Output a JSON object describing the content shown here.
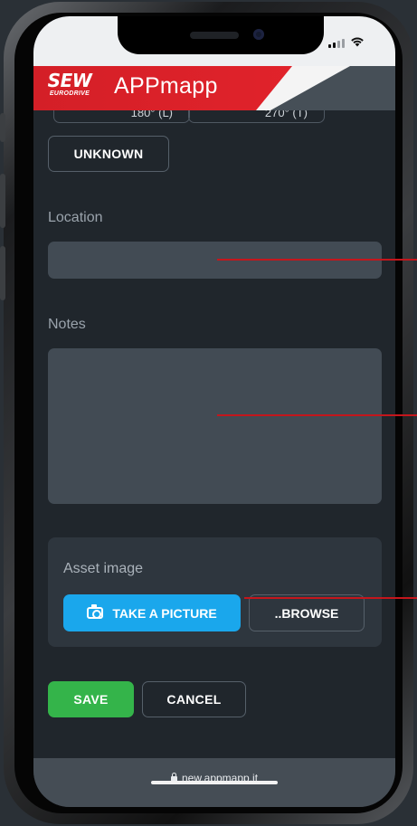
{
  "header": {
    "logo_main": "SEW",
    "logo_sub": "EURODRIVE",
    "app_name": "APPmapp"
  },
  "form": {
    "angle_options": [
      "180° (L)",
      "270° (T)"
    ],
    "unknown_label": "UNKNOWN",
    "location_label": "Location",
    "location_value": "",
    "notes_label": "Notes",
    "notes_value": "",
    "asset_image_label": "Asset image",
    "take_picture_label": "TAKE A PICTURE",
    "browse_label": "..BROWSE",
    "save_label": "SAVE",
    "cancel_label": "CANCEL"
  },
  "browser": {
    "url": "new.appmapp.it"
  },
  "icons": {
    "camera": "camera-icon",
    "lock": "lock-icon",
    "signal": "signal-icon",
    "wifi": "wifi-icon"
  },
  "colors": {
    "brand_red": "#d41f27",
    "primary_blue": "#1aa7ec",
    "save_green": "#34b44a",
    "background": "#20262c",
    "input_bg": "#424b54",
    "annotation_line": "#c4161c"
  }
}
